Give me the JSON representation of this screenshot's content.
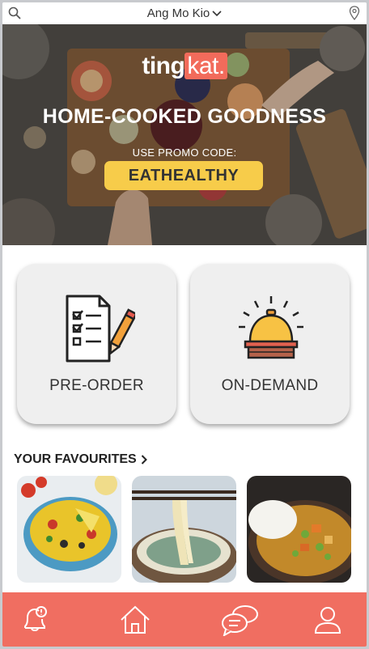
{
  "topbar": {
    "location": "Ang Mo Kio",
    "search_icon": "search-icon",
    "location_icon": "map-pin-icon"
  },
  "hero": {
    "logo_part1": "ting",
    "logo_part2": "kat.",
    "title": "HOME-COOKED GOODNESS",
    "promo_label": "USE PROMO CODE:",
    "promo_code": "EATHEALTHY"
  },
  "modes": {
    "preorder_label": "PRE-ORDER",
    "preorder_icon": "checklist-icon",
    "ondemand_label": "ON-DEMAND",
    "ondemand_icon": "service-bell-icon"
  },
  "favourites": {
    "heading": "YOUR FAVOURITES",
    "items": [
      {
        "icon": "rice-dish-image"
      },
      {
        "icon": "noodle-soup-image"
      },
      {
        "icon": "curry-rice-image"
      }
    ]
  },
  "nav": {
    "items": [
      {
        "icon": "notification-bell-icon"
      },
      {
        "icon": "home-icon"
      },
      {
        "icon": "chat-icon"
      },
      {
        "icon": "profile-icon"
      }
    ]
  },
  "colors": {
    "accent": "#f06e61",
    "promo": "#f7cc4a",
    "card": "#efefef"
  }
}
